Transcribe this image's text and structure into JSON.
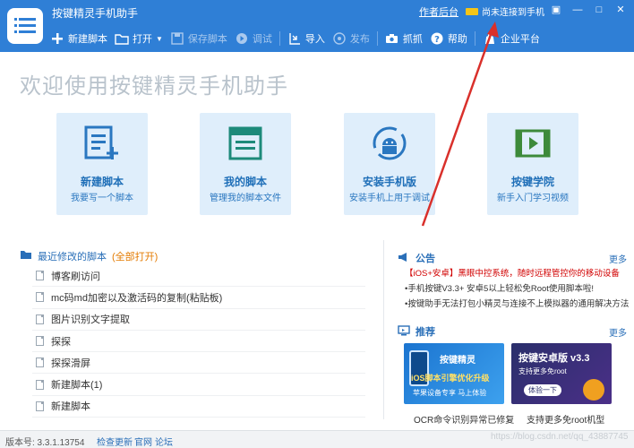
{
  "app": {
    "title": "按键精灵手机助手",
    "author_link": "作者后台",
    "connection_status": "尚未连接到手机",
    "window_buttons": [
      "▣",
      "—",
      "□",
      "✕"
    ]
  },
  "toolbar": {
    "new_script": "新建脚本",
    "open": "打开",
    "save_script": "保存脚本",
    "debug": "调试",
    "import": "导入",
    "publish": "发布",
    "capture": "抓抓",
    "help": "帮助",
    "enterprise": "企业平台"
  },
  "welcome": "欢迎使用按键精灵手机助手",
  "cards": [
    {
      "title": "新建脚本",
      "desc": "我要写一个脚本",
      "icon": "new-script-icon"
    },
    {
      "title": "我的脚本",
      "desc": "管理我的脚本文件",
      "icon": "my-scripts-icon"
    },
    {
      "title": "安装手机版",
      "desc": "安装手机上用于调试",
      "icon": "android-install-icon"
    },
    {
      "title": "按键学院",
      "desc": "新手入门学习视频",
      "icon": "video-academy-icon"
    }
  ],
  "recent": {
    "heading": "最近修改的脚本",
    "open_all": "(全部打开)",
    "items": [
      "博客刷访问",
      "mc码md加密以及激活码的复制(粘贴板)",
      "图片识别文字提取",
      "探探",
      "探探滑屏",
      "新建脚本(1)",
      "新建脚本"
    ]
  },
  "announcements": {
    "heading": "公告",
    "more": "更多",
    "items": [
      {
        "text": "【iOS+安卓】黑眼中控系统，随时远程管控你的移动设备",
        "hot": true
      },
      {
        "text": "•手机按键V3.3+ 安卓5以上轻松免Root使用脚本啦!",
        "hot": false
      },
      {
        "text": "•按键助手无法打包小精灵与连接不上模拟器的通用解决方法",
        "hot": false
      }
    ]
  },
  "recommend": {
    "heading": "推荐",
    "more": "更多",
    "promos": [
      {
        "line1": "按键精灵",
        "line2": "iOS脚本引擎优化升级",
        "line3": "苹果设备专享 马上体验",
        "caption": "OCR命令识别异常已修复"
      },
      {
        "line1": "按键安卓版 v3.3",
        "line2": "支持更多免root",
        "line3": "体验一下",
        "caption": "支持更多免root机型"
      }
    ]
  },
  "status": {
    "version": "版本号: 3.3.1.13754",
    "check_update": "检查更新",
    "website": "官网",
    "forum": "论坛",
    "watermark": "https://blog.csdn.net/qq_43887745"
  },
  "colors": {
    "primary": "#2f7fd6",
    "card_bg": "#dfeefb",
    "accent_red": "#d9302b",
    "orange": "#e37a00"
  }
}
